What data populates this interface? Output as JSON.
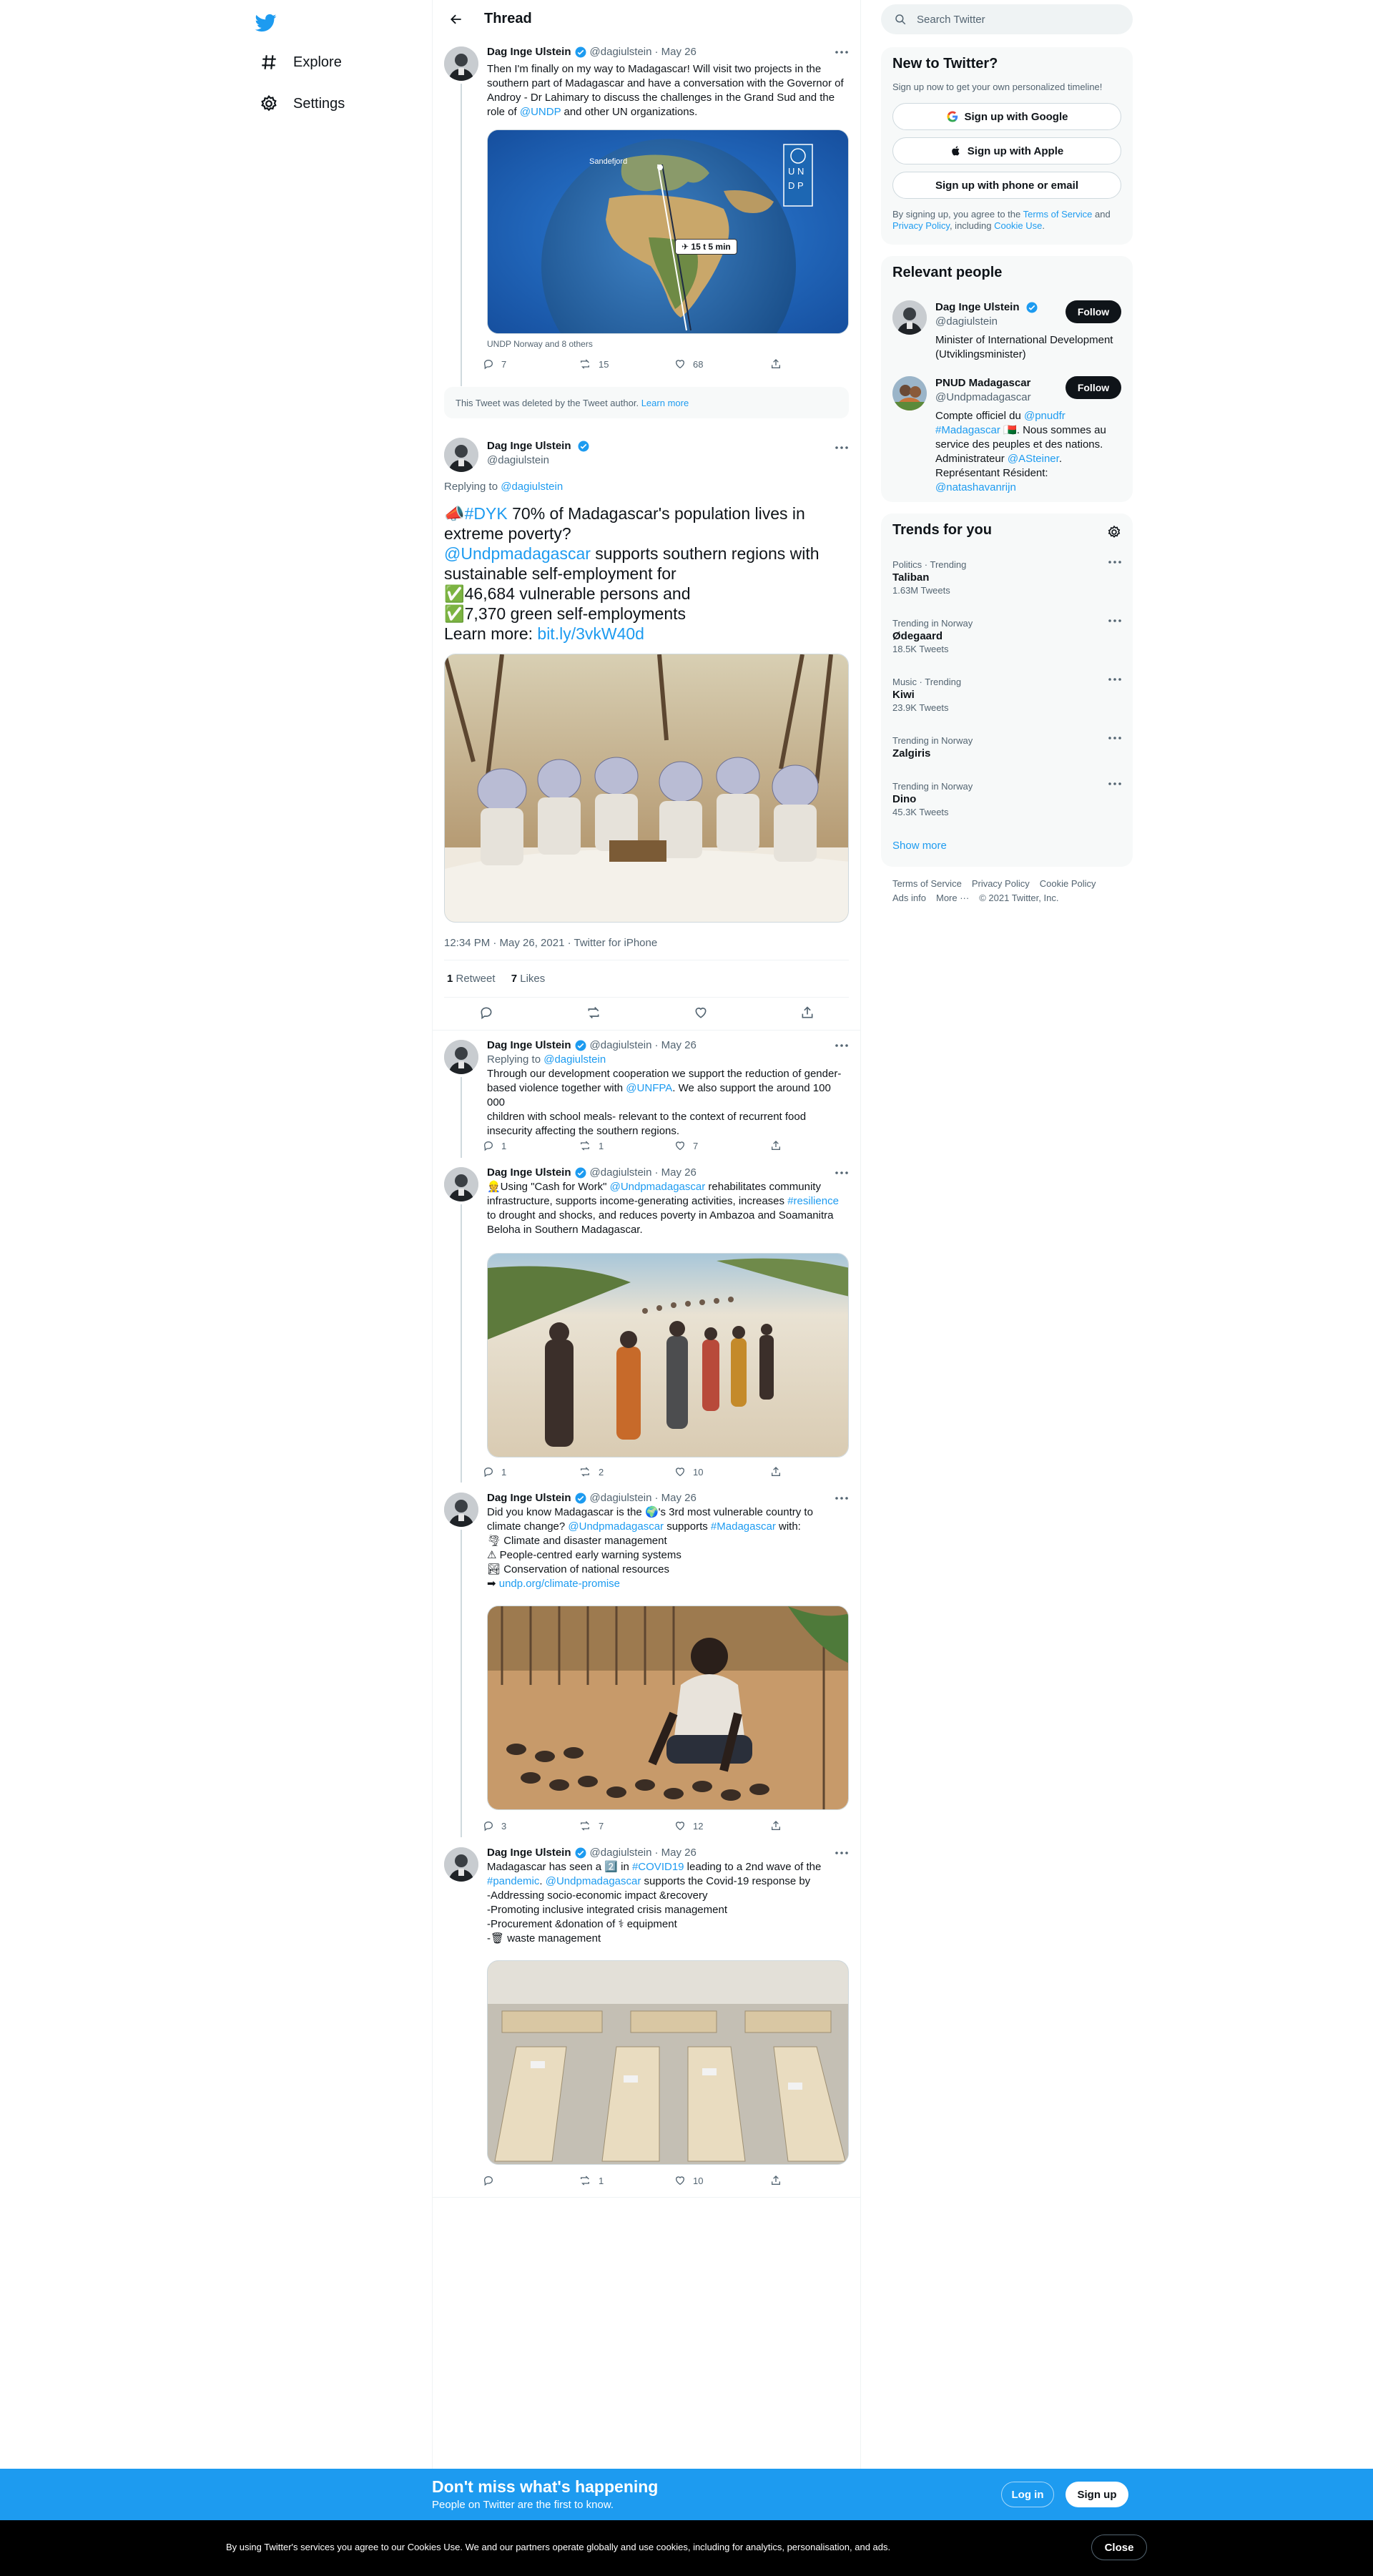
{
  "nav": {
    "items": [
      {
        "label": "Explore",
        "icon": "hashtag-icon"
      },
      {
        "label": "Settings",
        "icon": "gear-icon"
      }
    ]
  },
  "header": {
    "title": "Thread"
  },
  "tweets": [
    {
      "name": "Dag Inge Ulstein",
      "handle": "@dagiulstein",
      "date": "· May 26",
      "lines": [
        "Then I'm finally on my way to Madagascar! Will visit two projects in the",
        "southern part of Madagascar and have a conversation with the Governor of",
        "Androy - Dr Lahimary to discuss the challenges in the Grand Sud and the"
      ],
      "last_line_pre": "role of ",
      "last_line_link": "@UNDP",
      "last_line_post": " and other UN organizations.",
      "map_label": "✈ 15 t 5 min",
      "map_city": "Sandefjord",
      "tagged": "UNDP Norway and 8 others",
      "replies": "7",
      "retweets": "15",
      "likes": "68"
    }
  ],
  "deleted_notice": {
    "text": "This Tweet was deleted by the Tweet author.",
    "link": "Learn more"
  },
  "main_tweet": {
    "name": "Dag Inge Ulstein",
    "handle": "@dagiulstein",
    "replying_label": "Replying to",
    "replying_handle": "@dagiulstein",
    "hashtag": "#DYK",
    "line1": " 70% of Madagascar's population lives in",
    "line2": "extreme poverty?",
    "mention": "@Undpmadagascar",
    "line3": " supports southern regions with",
    "line4": "sustainable self-employment for",
    "line5": "46,684 vulnerable persons and",
    "line6": "7,370 green self-employments",
    "learn_label": "Learn more: ",
    "learn_link": "bit.ly/3vkW40d",
    "timestamp": "12:34 PM · May 26, 2021 · Twitter for iPhone",
    "retweet_count": "1",
    "retweet_label": " Retweet",
    "like_count": "7",
    "like_label": " Likes"
  },
  "replies": [
    {
      "name": "Dag Inge Ulstein",
      "handle": "@dagiulstein",
      "date": "· May 26",
      "replying_label": "Replying to ",
      "replying_handle": "@dagiulstein",
      "l1": "Through our development cooperation we support the reduction of gender-",
      "l2_pre": "based violence together with ",
      "l2_link": "@UNFPA",
      "l2_post": ". We also support the around 100 000",
      "l3": "children with school meals- relevant to the context of recurrent food",
      "l4": "insecurity affecting the southern regions.",
      "replies": "1",
      "retweets": "1",
      "likes": "7"
    },
    {
      "name": "Dag Inge Ulstein",
      "handle": "@dagiulstein",
      "date": "· May 26",
      "l1_pre": "👷Using \"Cash for Work\" ",
      "l1_link": "@Undpmadagascar",
      "l1_post": " rehabilitates community",
      "l2_pre": "infrastructure, supports income-generating activities, increases ",
      "l2_link": "#resilience",
      "l3": "to drought and shocks, and reduces poverty in Ambazoa and Soamanitra",
      "l4": "Beloha in Southern Madagascar.",
      "replies": "1",
      "retweets": "2",
      "likes": "10"
    },
    {
      "name": "Dag Inge Ulstein",
      "handle": "@dagiulstein",
      "date": "· May 26",
      "l1": "Did you know Madagascar is the 🌍's 3rd most vulnerable country to",
      "l2_pre": "climate change? ",
      "l2_link1": "@Undpmadagascar",
      "l2_mid": " supports ",
      "l2_link2": "#Madagascar",
      "l2_post": " with:",
      "l3": "🌪 Climate and disaster management",
      "l4": "⚠ People-centred early warning systems",
      "l5": "🏞 Conservation of national resources",
      "l6_pre": "➡ ",
      "l6_link": "undp.org/climate-promise",
      "replies": "3",
      "retweets": "7",
      "likes": "12"
    },
    {
      "name": "Dag Inge Ulstein",
      "handle": "@dagiulstein",
      "date": "· May 26",
      "l1_pre": "Madagascar has seen a 2️⃣ in ",
      "l1_link": "#COVID19",
      "l1_post": " leading to a 2nd wave of the",
      "l2_link1": "#pandemic",
      "l2_mid": ". ",
      "l2_link2": "@Undpmadagascar",
      "l2_post": " supports the Covid-19 response by",
      "l3": "-Addressing socio-economic impact &recovery",
      "l4": "-Promoting inclusive integrated crisis management",
      "l5": "-Procurement &donation of ⚕ equipment",
      "l6": "-🗑 waste management",
      "replies": "",
      "retweets": "1",
      "likes": "10"
    }
  ],
  "sidebar": {
    "search_placeholder": "Search Twitter",
    "new_title": "New to Twitter?",
    "new_sub": "Sign up now to get your own personalized timeline!",
    "btn_google": "Sign up with Google",
    "btn_apple": "Sign up with Apple",
    "btn_email": "Sign up with phone or email",
    "terms_pre": "By signing up, you agree to the ",
    "terms_link": "Terms of Service",
    "terms_and": " and",
    "privacy_link": "Privacy Policy",
    "terms_incl": ", including ",
    "cookie_link": "Cookie Use",
    "terms_end": ".",
    "relevant_title": "Relevant people",
    "people": [
      {
        "name": "Dag Inge Ulstein",
        "handle": "@dagiulstein",
        "follow": "Follow",
        "bio1": "Minister of International Development",
        "bio2": "(Utviklingsminister)"
      },
      {
        "name": "PNUD Madagascar",
        "handle": "@Undpmadagascar",
        "follow": "Follow",
        "bio1_pre": "Compte officiel du ",
        "bio1_link": "@pnudfr",
        "bio2_link": "#Madagascar",
        "bio2_post": " 🇲🇬. Nous sommes au",
        "bio3": "service des peuples et des nations.",
        "bio4_pre": "Administrateur ",
        "bio4_link": "@ASteiner",
        "bio4_post": ".",
        "bio5": "Représentant Résident:",
        "bio6_link": "@natashavanrijn"
      }
    ],
    "trends_title": "Trends for you",
    "trends": [
      {
        "cat": "Politics · Trending",
        "name": "Taliban",
        "count": "1.63M Tweets"
      },
      {
        "cat": "Trending in Norway",
        "name": "Ødegaard",
        "count": "18.5K Tweets"
      },
      {
        "cat": "Music · Trending",
        "name": "Kiwi",
        "count": "23.9K Tweets"
      },
      {
        "cat": "Trending in Norway",
        "name": "Zalgiris",
        "count": ""
      },
      {
        "cat": "Trending in Norway",
        "name": "Dino",
        "count": "45.3K Tweets"
      }
    ],
    "show_more": "Show more",
    "footer": [
      "Terms of Service",
      "Privacy Policy",
      "Cookie Policy",
      "Ads info",
      "More ···",
      "© 2021 Twitter, Inc."
    ]
  },
  "bottom": {
    "title": "Don't miss what's happening",
    "sub": "People on Twitter are the first to know.",
    "login": "Log in",
    "signup": "Sign up"
  },
  "cookie": {
    "text": "By using Twitter's services you agree to our Cookies Use. We and our partners operate globally and use cookies, including for analytics, personalisation, and ads.",
    "close": "Close"
  },
  "colors": {
    "accent": "#1d9bf0",
    "text": "#0f1419",
    "muted": "#536471",
    "border": "#eff3f4",
    "sidebar_bg": "#f7f9f9"
  }
}
